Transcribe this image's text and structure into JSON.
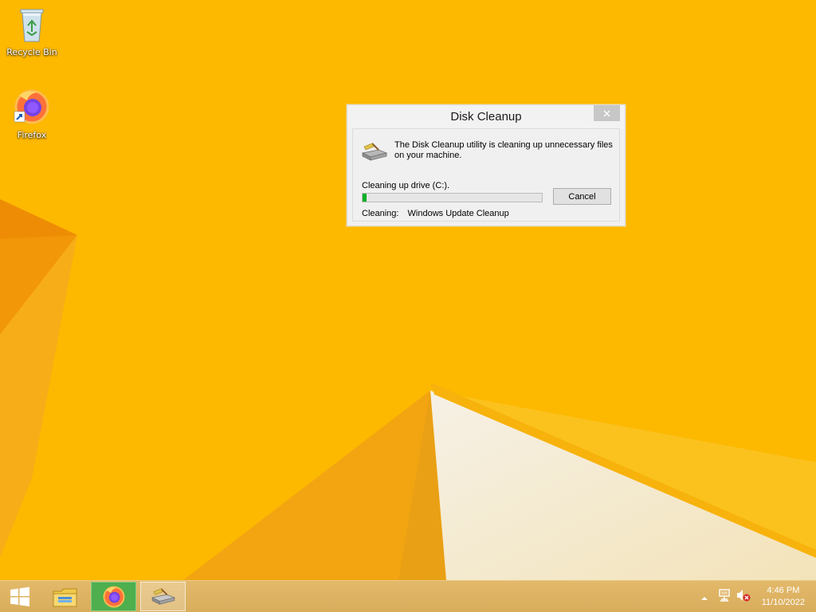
{
  "desktop": {
    "icons": [
      {
        "label": "Recycle Bin",
        "icon": "recycle-bin-icon"
      },
      {
        "label": "Firefox",
        "icon": "firefox-icon"
      }
    ]
  },
  "dialog": {
    "title": "Disk Cleanup",
    "close_icon": "close-icon",
    "message": "The Disk Cleanup utility is cleaning up unnecessary files on your machine.",
    "drive_label": "Cleaning up drive  (C:).",
    "progress": 0.02,
    "progress_color": "#06b025",
    "cancel_label": "Cancel",
    "cleaning_label": "Cleaning:",
    "cleaning_value": "Windows Update Cleanup"
  },
  "taskbar": {
    "buttons": [
      {
        "icon": "windows-start-icon"
      },
      {
        "icon": "file-explorer-icon"
      },
      {
        "icon": "firefox-icon",
        "active": true
      },
      {
        "icon": "disk-cleanup-icon"
      }
    ],
    "tray": {
      "icons": [
        "show-hidden-icons-chevron-icon",
        "network-icon",
        "volume-muted-icon"
      ],
      "time": "4:46 PM",
      "date": "11/10/2022"
    }
  },
  "colors": {
    "wallpaper": "#fdb800",
    "taskbar": "#dcb061"
  }
}
